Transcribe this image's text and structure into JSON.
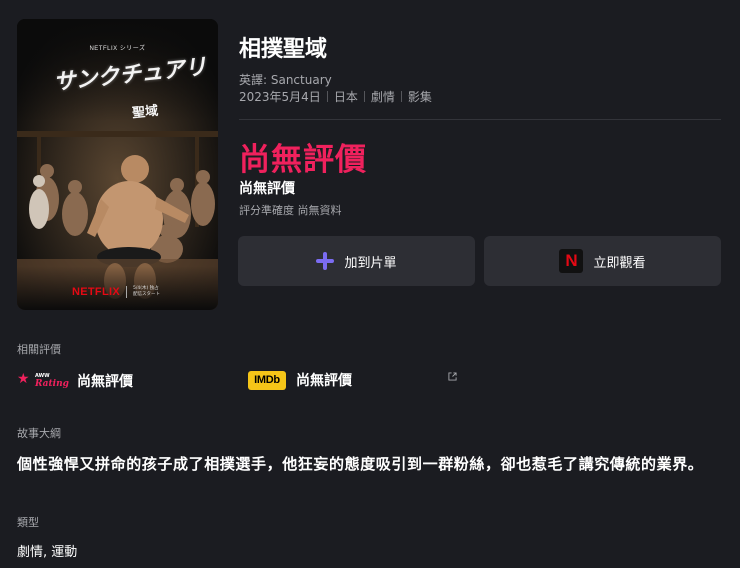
{
  "poster": {
    "header": "NETFLIX シリーズ",
    "title_jp": "サンクチュアリ",
    "subtitle_jp": "聖域",
    "brand": "NETFLIX",
    "date_note": "5/4(木) 独占配信スタート"
  },
  "title": "相撲聖域",
  "english_title_line": "英譯: Sanctuary",
  "meta": {
    "date": "2023年5月4日",
    "country": "日本",
    "genre_tag": "劇情",
    "type": "影集"
  },
  "rating": {
    "headline": "尚無評價",
    "label": "尚無評價",
    "note": "評分準確度 尚無資料"
  },
  "buttons": {
    "add_label": "加到片單",
    "watch_label": "立即觀看",
    "watch_icon_letter": "N"
  },
  "related": {
    "section_label": "相關評價",
    "aww": {
      "logo_top": "AWW",
      "logo_bottom": "Rating",
      "value": "尚無評價"
    },
    "imdb": {
      "logo": "IMDb",
      "value": "尚無評價"
    }
  },
  "synopsis": {
    "section_label": "故事大綱",
    "text": "個性強悍又拼命的孩子成了相撲選手，他狂妄的態度吸引到一群粉絲，卻也惹毛了講究傳統的業界。"
  },
  "genre": {
    "section_label": "類型",
    "value": "劇情, 運動"
  },
  "colors": {
    "background": "#1b1c21",
    "accent_pink": "#f0215d",
    "button_bg": "#2d2e34",
    "plus_purple": "#7b6cf2",
    "netflix_red": "#e50914",
    "imdb_yellow": "#f5c518"
  }
}
